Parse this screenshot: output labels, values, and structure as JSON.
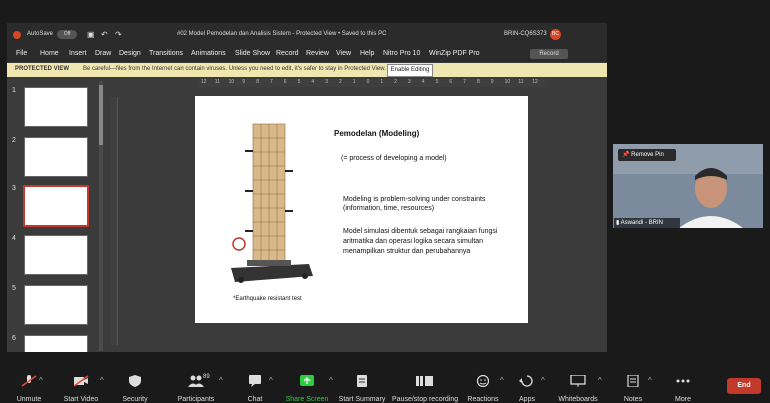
{
  "ppt": {
    "title": "#02 Model Pemodelan dan Analisis Sistem - Protected View • Saved to this PC",
    "autosave_label": "AutoSave",
    "autosave_state": "Off",
    "user_id": "BRIN-CQ6S373",
    "avatar_initials": "BC",
    "record_btn": "Record",
    "menu": [
      "File",
      "Home",
      "Insert",
      "Draw",
      "Design",
      "Transitions",
      "Animations",
      "Slide Show",
      "Record",
      "Review",
      "View",
      "Help",
      "Nitro Pro 10",
      "WinZip PDF Pro"
    ],
    "protected": {
      "label": "PROTECTED VIEW",
      "message": "Be careful—files from the Internet can contain viruses. Unless you need to edit, it's safer to stay in Protected View.",
      "button": "Enable Editing"
    },
    "thumbnails": [
      "1",
      "2",
      "3",
      "4",
      "5",
      "6"
    ],
    "selected_slide": 3,
    "ruler_ticks": [
      "12",
      "11",
      "10",
      "9",
      "8",
      "7",
      "6",
      "5",
      "4",
      "3",
      "2",
      "1",
      "0",
      "1",
      "2",
      "3",
      "4",
      "5",
      "6",
      "7",
      "8",
      "9",
      "10",
      "11",
      "12"
    ],
    "slide": {
      "heading": "Pemodelan (Modeling)",
      "sub": "(= process of developing a model)",
      "p1a": "Modeling is problem-solving under constraints",
      "p1b": "(information, time, resources)",
      "p2a": "Model simulasi dibentuk sebagai rangkaian fungsi",
      "p2b": "aritmatika dan operasi logika secara simultan",
      "p2c": "menampilkan struktur dan perubahannya",
      "caption": "*Earthquake resistant test"
    }
  },
  "video": {
    "remove_pin": "Remove Pin",
    "participant": "Aswandi - BRIN"
  },
  "toolbar": {
    "unmute": "Unmute",
    "start_video": "Start Video",
    "security": "Security",
    "participants": "Participants",
    "participants_count": "89",
    "chat": "Chat",
    "share_screen": "Share Screen",
    "start_summary": "Start Summary",
    "pause_recording": "Pause/stop recording",
    "reactions": "Reactions",
    "apps": "Apps",
    "whiteboards": "Whiteboards",
    "notes": "Notes",
    "more": "More",
    "end": "End"
  },
  "colors": {
    "accent_green": "#2ecc40",
    "end_red": "#c0392b",
    "protected_bg": "#f0e6b0",
    "selected_thumb": "#c0392b"
  }
}
